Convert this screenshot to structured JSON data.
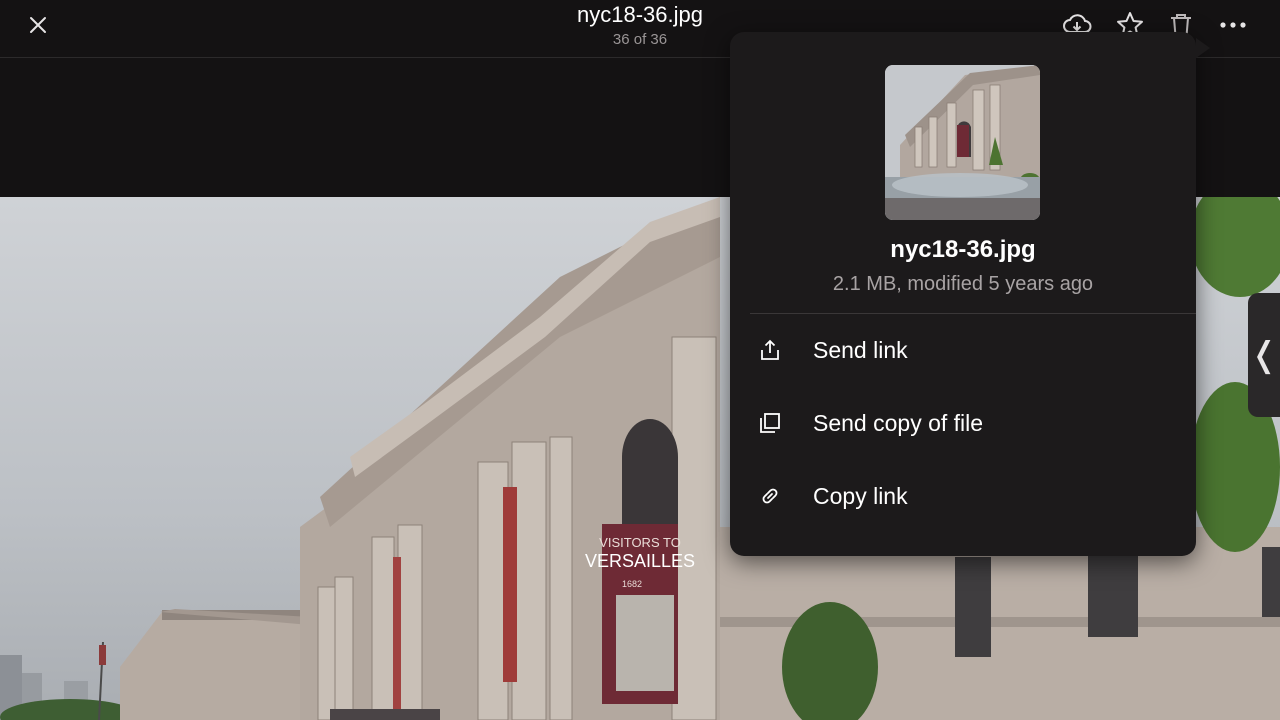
{
  "header": {
    "title": "nyc18-36.jpg",
    "counter": "36 of 36",
    "icons": [
      "close-icon",
      "cloud-download-icon",
      "star-icon",
      "trash-icon",
      "more-icon"
    ]
  },
  "photo": {
    "banner_line1": "VISITORS TO",
    "banner_line2": "VERSAILLES",
    "banner_year": "1682"
  },
  "menu": {
    "file_name": "nyc18-36.jpg",
    "file_meta": "2.1 MB, modified 5 years ago",
    "items": [
      {
        "label": "Send link",
        "icon": "share-icon"
      },
      {
        "label": "Send copy of file",
        "icon": "copy-file-icon"
      },
      {
        "label": "Copy link",
        "icon": "link-icon"
      }
    ]
  },
  "side_handle": {
    "glyph": "❬"
  },
  "colors": {
    "background": "#141213",
    "menu_bg": "#1c1a1b",
    "text_secondary": "#a8a3a4"
  }
}
